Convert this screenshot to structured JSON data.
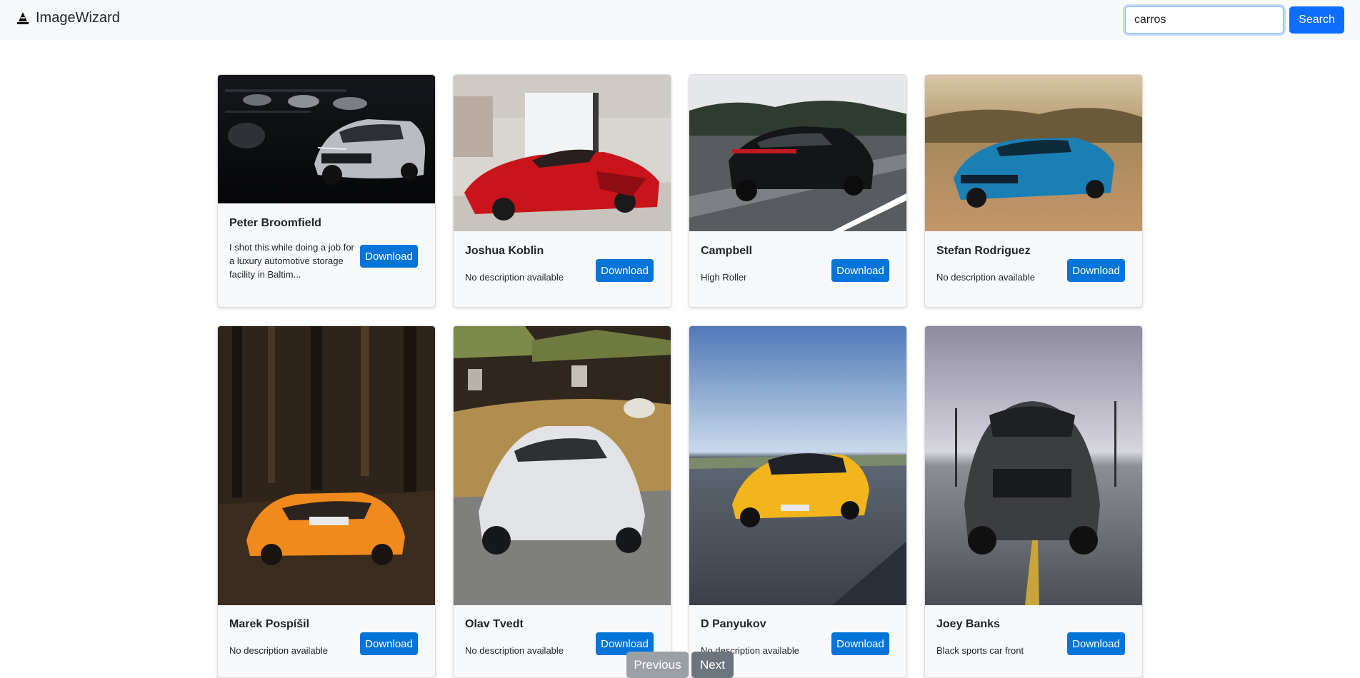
{
  "app": {
    "name": "ImageWizard"
  },
  "search": {
    "value": "carros",
    "button_label": "Search"
  },
  "cards": [
    {
      "author": "Peter Broomfield",
      "description": "I shot this while doing a job for a luxury automotive storage facility in Baltim...",
      "download_label": "Download"
    },
    {
      "author": "Joshua Koblin",
      "description": "No description available",
      "download_label": "Download"
    },
    {
      "author": "Campbell",
      "description": "High Roller",
      "download_label": "Download"
    },
    {
      "author": "Stefan Rodriguez",
      "description": "No description available",
      "download_label": "Download"
    },
    {
      "author": "Marek Pospíšil",
      "description": "No description available",
      "download_label": "Download"
    },
    {
      "author": "Olav Tvedt",
      "description": "No description available",
      "download_label": "Download"
    },
    {
      "author": "D Panyukov",
      "description": "No description available",
      "download_label": "Download"
    },
    {
      "author": "Joey Banks",
      "description": "Black sports car front",
      "download_label": "Download"
    }
  ],
  "pagination": {
    "previous_label": "Previous",
    "next_label": "Next"
  },
  "colors": {
    "primary": "#0d6efd",
    "download": "#0074d9",
    "navbar_bg": "#f8f9fa"
  }
}
